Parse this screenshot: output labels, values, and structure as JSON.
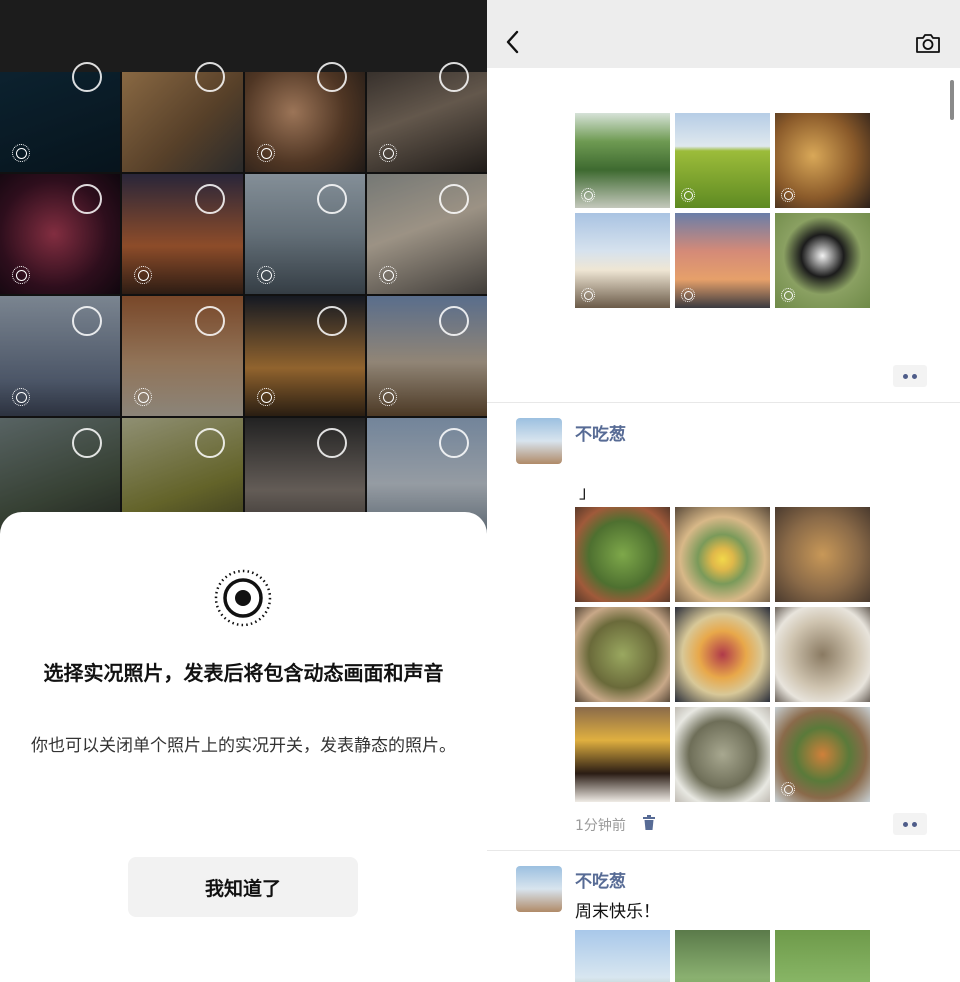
{
  "picker_sheet": {
    "title": "选择实况照片，发表后将包含动态画面和声音",
    "description": "你也可以关闭单个照片上的实况开关，发表静态的照片。",
    "confirm_label": "我知道了"
  },
  "moments": {
    "posts": [
      {
        "username": "不吃葱",
        "text": "」",
        "time": "1分钟前"
      },
      {
        "username": "不吃葱",
        "text": "周末快乐！"
      }
    ]
  },
  "icons": {
    "back": "chevron-left-icon",
    "camera": "camera-icon",
    "live_photo": "live-photo-icon",
    "select": "selection-circle-icon",
    "more": "more-dots-icon",
    "trash": "trash-icon"
  },
  "colors": {
    "username": "#576b95",
    "nav_bg": "#ededed",
    "sheet_bg": "#ffffff"
  }
}
